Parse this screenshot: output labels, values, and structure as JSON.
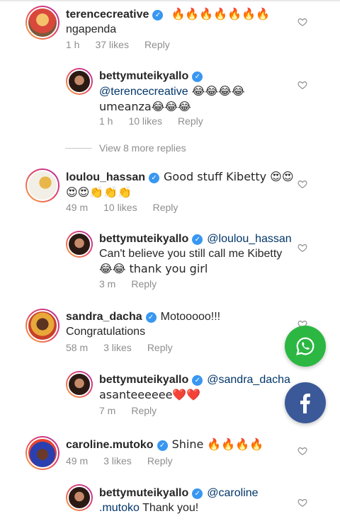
{
  "comments": [
    {
      "username": "terencecreative",
      "text": " 🔥🔥🔥🔥🔥🔥🔥",
      "line2": "ngapenda",
      "time": "1 h",
      "likes": "37 likes",
      "reply": "Reply"
    },
    {
      "username": "bettymuteikyallo",
      "mention": "@terencecreative",
      "text": " 😂😂😂😂",
      "line2": "umeanza😂😂😂",
      "time": "1 h",
      "likes": "10 likes",
      "reply": "Reply"
    },
    {
      "username": "loulou_hassan",
      "text": "Good stuff Kibetty 😍😍",
      "line2": "😍😍👏👏👏",
      "time": "49 m",
      "likes": "10 likes",
      "reply": "Reply"
    },
    {
      "username": "bettymuteikyallo",
      "mention": "@loulou_hassan",
      "line2": "Can't believe you still call me Kibetty",
      "line3": "😂😂 thank you girl",
      "time": "3 m",
      "reply": "Reply"
    },
    {
      "username": "sandra_dacha",
      "text": "Motooooo!!!",
      "line2": "Congratulations",
      "time": "58 m",
      "likes": "3 likes",
      "reply": "Reply"
    },
    {
      "username": "bettymuteikyallo",
      "mention": "@sandra_dacha",
      "line2": "asanteeeeee❤️❤️",
      "time": "7 m",
      "reply": "Reply"
    },
    {
      "username": "caroline.mutoko",
      "text": "Shine 🔥🔥🔥🔥",
      "time": "49 m",
      "likes": "3 likes",
      "reply": "Reply"
    },
    {
      "username": "bettymuteikyallo",
      "mention": "@caroline",
      "line2_mention": ".mutoko",
      "line2": " Thank you!"
    }
  ],
  "view_more": "View 8 more replies",
  "icons": {
    "heart": "heart-outline-icon",
    "whatsapp": "whatsapp-icon",
    "facebook": "facebook-icon",
    "verified": "verified-badge-icon"
  },
  "colors": {
    "whatsapp": "#2cb742",
    "facebook": "#3b5998",
    "verified": "#3897f0",
    "mention": "#003569",
    "meta": "#8e8e8e"
  }
}
